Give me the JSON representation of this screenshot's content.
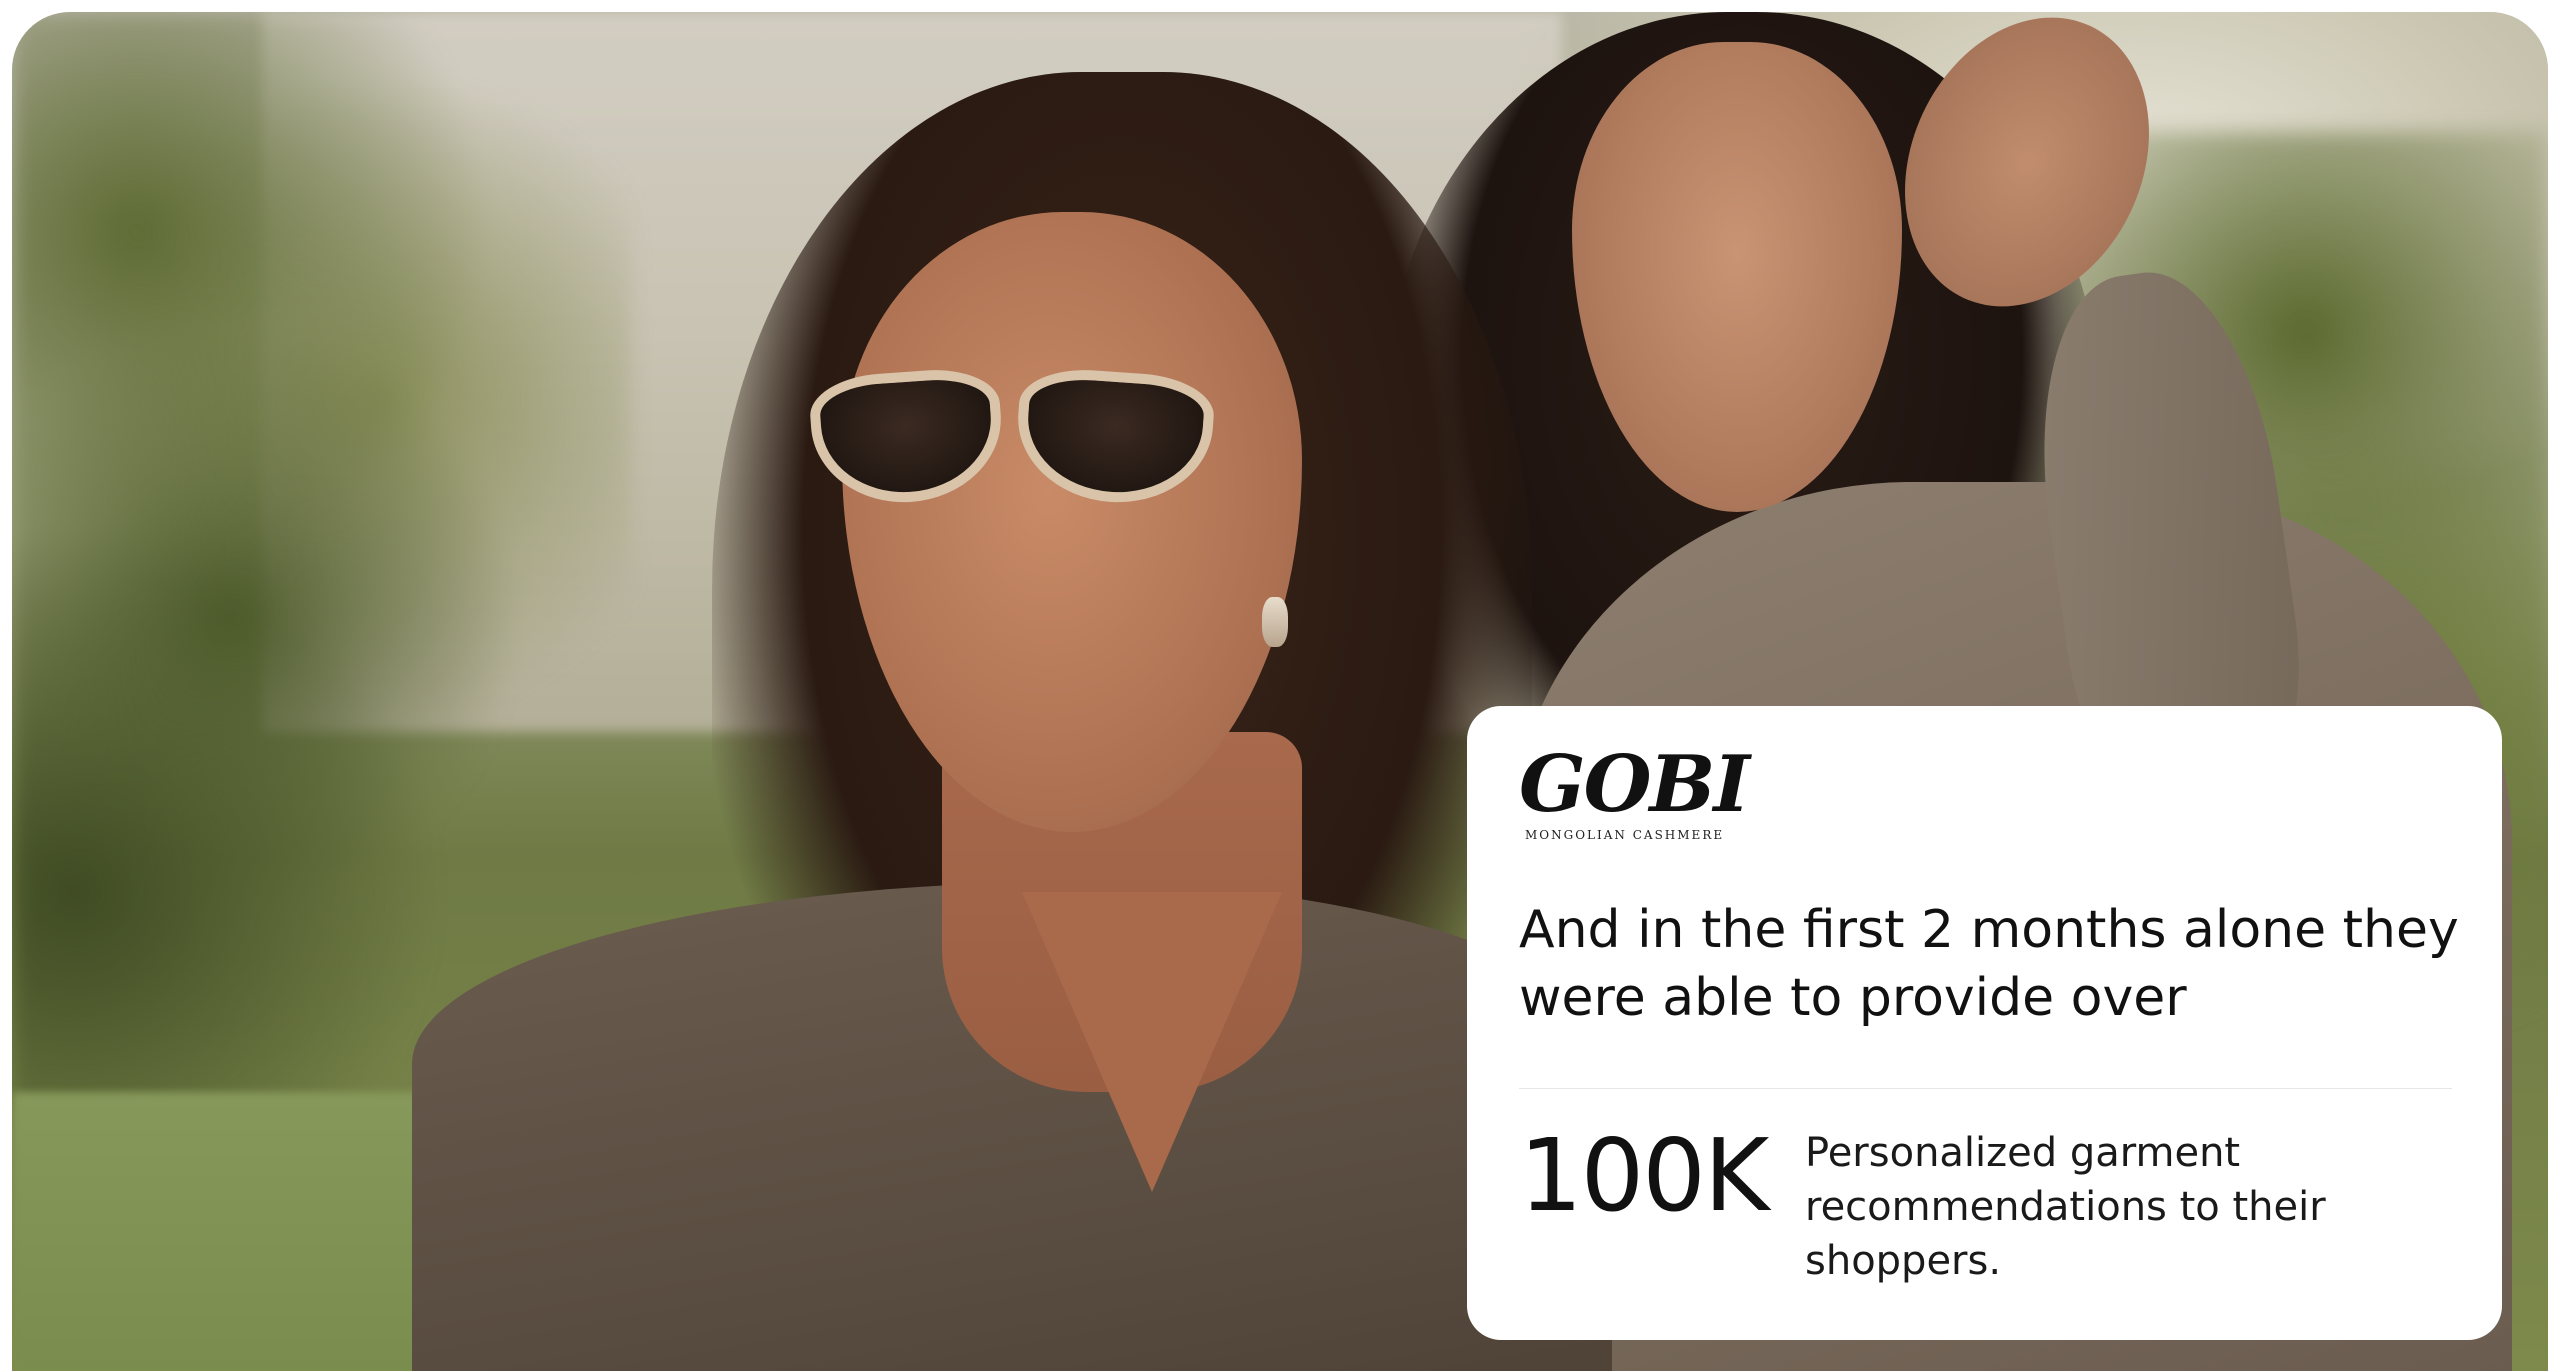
{
  "hero": {
    "image_alt": "Two women outdoors wearing cashmere sweaters"
  },
  "card": {
    "brand": {
      "name": "GOBI",
      "tagline": "MONGOLIAN CASHMERE"
    },
    "headline": "And in the first 2 months alone they were able to provide over",
    "stat": {
      "value": "100K",
      "description": "Personalized garment recommendations to their shoppers."
    }
  },
  "colors": {
    "card_background": "#ffffff",
    "text_primary": "#111111",
    "divider": "#e6e6e6"
  }
}
